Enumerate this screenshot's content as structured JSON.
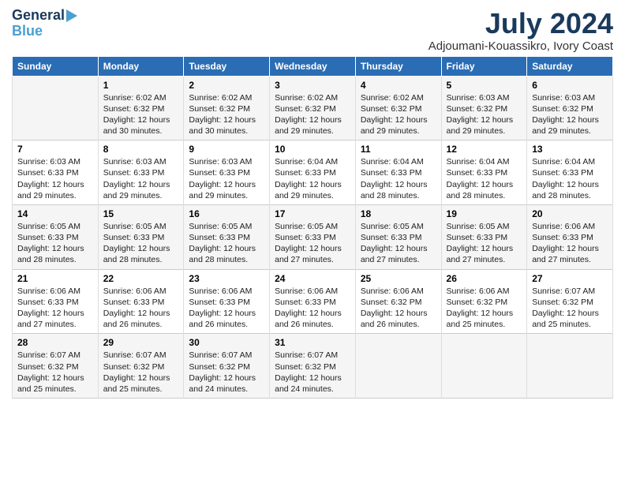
{
  "logo": {
    "line1": "General",
    "line2": "Blue"
  },
  "title": "July 2024",
  "subtitle": "Adjoumani-Kouassikro, Ivory Coast",
  "header": {
    "accent_color": "#2a6db5"
  },
  "days_of_week": [
    "Sunday",
    "Monday",
    "Tuesday",
    "Wednesday",
    "Thursday",
    "Friday",
    "Saturday"
  ],
  "weeks": [
    {
      "cells": [
        {
          "day": "",
          "content": ""
        },
        {
          "day": "1",
          "content": "Sunrise: 6:02 AM\nSunset: 6:32 PM\nDaylight: 12 hours\nand 30 minutes."
        },
        {
          "day": "2",
          "content": "Sunrise: 6:02 AM\nSunset: 6:32 PM\nDaylight: 12 hours\nand 30 minutes."
        },
        {
          "day": "3",
          "content": "Sunrise: 6:02 AM\nSunset: 6:32 PM\nDaylight: 12 hours\nand 29 minutes."
        },
        {
          "day": "4",
          "content": "Sunrise: 6:02 AM\nSunset: 6:32 PM\nDaylight: 12 hours\nand 29 minutes."
        },
        {
          "day": "5",
          "content": "Sunrise: 6:03 AM\nSunset: 6:32 PM\nDaylight: 12 hours\nand 29 minutes."
        },
        {
          "day": "6",
          "content": "Sunrise: 6:03 AM\nSunset: 6:32 PM\nDaylight: 12 hours\nand 29 minutes."
        }
      ]
    },
    {
      "cells": [
        {
          "day": "7",
          "content": "Sunrise: 6:03 AM\nSunset: 6:33 PM\nDaylight: 12 hours\nand 29 minutes."
        },
        {
          "day": "8",
          "content": "Sunrise: 6:03 AM\nSunset: 6:33 PM\nDaylight: 12 hours\nand 29 minutes."
        },
        {
          "day": "9",
          "content": "Sunrise: 6:03 AM\nSunset: 6:33 PM\nDaylight: 12 hours\nand 29 minutes."
        },
        {
          "day": "10",
          "content": "Sunrise: 6:04 AM\nSunset: 6:33 PM\nDaylight: 12 hours\nand 29 minutes."
        },
        {
          "day": "11",
          "content": "Sunrise: 6:04 AM\nSunset: 6:33 PM\nDaylight: 12 hours\nand 28 minutes."
        },
        {
          "day": "12",
          "content": "Sunrise: 6:04 AM\nSunset: 6:33 PM\nDaylight: 12 hours\nand 28 minutes."
        },
        {
          "day": "13",
          "content": "Sunrise: 6:04 AM\nSunset: 6:33 PM\nDaylight: 12 hours\nand 28 minutes."
        }
      ]
    },
    {
      "cells": [
        {
          "day": "14",
          "content": "Sunrise: 6:05 AM\nSunset: 6:33 PM\nDaylight: 12 hours\nand 28 minutes."
        },
        {
          "day": "15",
          "content": "Sunrise: 6:05 AM\nSunset: 6:33 PM\nDaylight: 12 hours\nand 28 minutes."
        },
        {
          "day": "16",
          "content": "Sunrise: 6:05 AM\nSunset: 6:33 PM\nDaylight: 12 hours\nand 28 minutes."
        },
        {
          "day": "17",
          "content": "Sunrise: 6:05 AM\nSunset: 6:33 PM\nDaylight: 12 hours\nand 27 minutes."
        },
        {
          "day": "18",
          "content": "Sunrise: 6:05 AM\nSunset: 6:33 PM\nDaylight: 12 hours\nand 27 minutes."
        },
        {
          "day": "19",
          "content": "Sunrise: 6:05 AM\nSunset: 6:33 PM\nDaylight: 12 hours\nand 27 minutes."
        },
        {
          "day": "20",
          "content": "Sunrise: 6:06 AM\nSunset: 6:33 PM\nDaylight: 12 hours\nand 27 minutes."
        }
      ]
    },
    {
      "cells": [
        {
          "day": "21",
          "content": "Sunrise: 6:06 AM\nSunset: 6:33 PM\nDaylight: 12 hours\nand 27 minutes."
        },
        {
          "day": "22",
          "content": "Sunrise: 6:06 AM\nSunset: 6:33 PM\nDaylight: 12 hours\nand 26 minutes."
        },
        {
          "day": "23",
          "content": "Sunrise: 6:06 AM\nSunset: 6:33 PM\nDaylight: 12 hours\nand 26 minutes."
        },
        {
          "day": "24",
          "content": "Sunrise: 6:06 AM\nSunset: 6:33 PM\nDaylight: 12 hours\nand 26 minutes."
        },
        {
          "day": "25",
          "content": "Sunrise: 6:06 AM\nSunset: 6:32 PM\nDaylight: 12 hours\nand 26 minutes."
        },
        {
          "day": "26",
          "content": "Sunrise: 6:06 AM\nSunset: 6:32 PM\nDaylight: 12 hours\nand 25 minutes."
        },
        {
          "day": "27",
          "content": "Sunrise: 6:07 AM\nSunset: 6:32 PM\nDaylight: 12 hours\nand 25 minutes."
        }
      ]
    },
    {
      "cells": [
        {
          "day": "28",
          "content": "Sunrise: 6:07 AM\nSunset: 6:32 PM\nDaylight: 12 hours\nand 25 minutes."
        },
        {
          "day": "29",
          "content": "Sunrise: 6:07 AM\nSunset: 6:32 PM\nDaylight: 12 hours\nand 25 minutes."
        },
        {
          "day": "30",
          "content": "Sunrise: 6:07 AM\nSunset: 6:32 PM\nDaylight: 12 hours\nand 24 minutes."
        },
        {
          "day": "31",
          "content": "Sunrise: 6:07 AM\nSunset: 6:32 PM\nDaylight: 12 hours\nand 24 minutes."
        },
        {
          "day": "",
          "content": ""
        },
        {
          "day": "",
          "content": ""
        },
        {
          "day": "",
          "content": ""
        }
      ]
    }
  ]
}
